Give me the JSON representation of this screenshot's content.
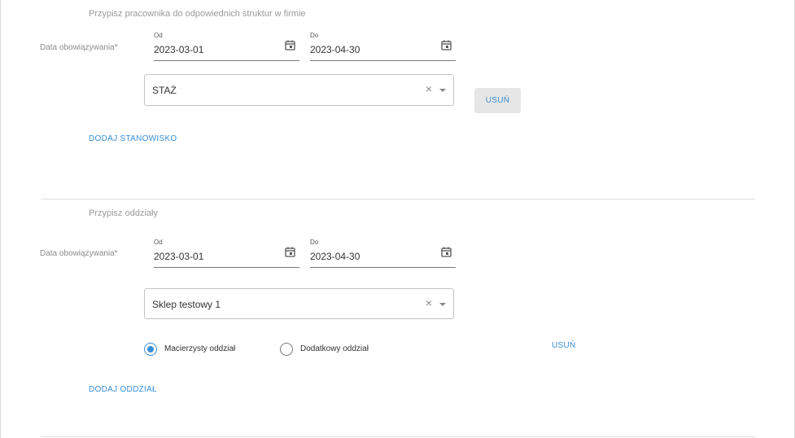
{
  "positions": {
    "title": "Przypisz pracownika do odpowiednich struktur w firmie",
    "date_label": "Data obowiązywania*",
    "from_label": "Od",
    "from_value": "2023-03-01",
    "to_label": "Do",
    "to_value": "2023-04-30",
    "select_value": "STAŻ",
    "clear_symbol": "×",
    "remove_label": "USUŃ",
    "add_label": "DODAJ STANOWISKO"
  },
  "branches": {
    "title": "Przypisz oddziały",
    "date_label": "Data obowiązywania*",
    "from_label": "Od",
    "from_value": "2023-03-01",
    "to_label": "Do",
    "to_value": "2023-04-30",
    "select_value": "Sklep testowy 1",
    "clear_symbol": "×",
    "radio_primary": "Macierzysty oddział",
    "radio_additional": "Dodatkowy oddział",
    "selected_radio": "primary",
    "remove_label": "USUŃ",
    "add_label": "DODAJ ODDZIAŁ"
  },
  "icons": {
    "calendar": "calendar-icon",
    "clear": "clear-icon",
    "dropdown": "chevron-down-icon"
  },
  "colors": {
    "accent": "#3a8ed6",
    "button_bg": "#e6e6e6"
  }
}
